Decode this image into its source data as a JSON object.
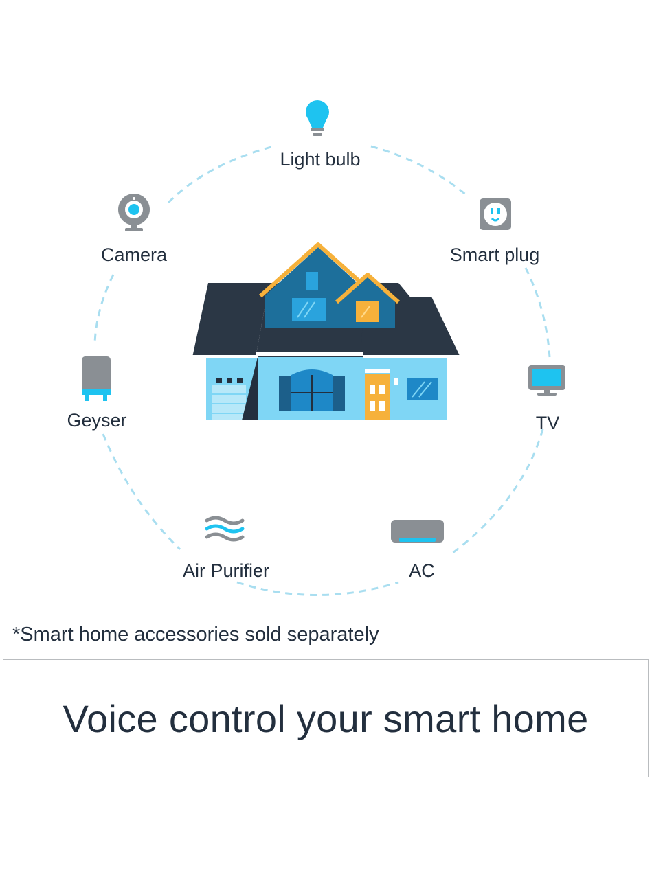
{
  "devices": {
    "light_bulb": "Light bulb",
    "camera": "Camera",
    "smart_plug": "Smart plug",
    "geyser": "Geyser",
    "tv": "TV",
    "air_purifier": "Air Purifier",
    "ac": "AC"
  },
  "footnote": "*Smart home accessories sold separately",
  "headline": "Voice control your smart home",
  "colors": {
    "accent_blue": "#1ec3f0",
    "icon_gray": "#8a8f94",
    "house_dark": "#232f3e",
    "house_light_blue": "#7fd6f5",
    "roof_orange": "#f6b13b",
    "dashed_circle": "#a9def0"
  }
}
